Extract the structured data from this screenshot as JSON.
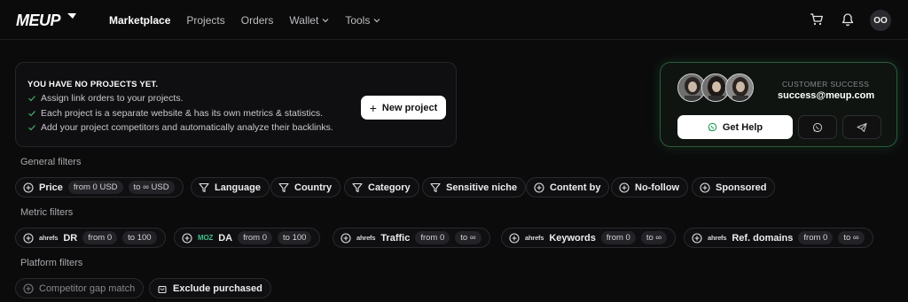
{
  "app": {
    "logo_text": "MEUP"
  },
  "nav": {
    "items": [
      {
        "label": "Marketplace",
        "active": true
      },
      {
        "label": "Projects"
      },
      {
        "label": "Orders"
      },
      {
        "label": "Wallet",
        "has_dropdown": true
      },
      {
        "label": "Tools",
        "has_dropdown": true
      }
    ]
  },
  "header_icons": {
    "cart": "cart-icon",
    "bell": "bell-icon",
    "avatar_initials": "OO"
  },
  "projects_card": {
    "title": "YOU HAVE NO PROJECTS YET.",
    "items": [
      "Assign link orders to your projects.",
      "Each project is a separate website & has its own metrics & statistics.",
      "Add your project competitors and automatically analyze their backlinks."
    ],
    "button_label": "New project"
  },
  "support_card": {
    "label": "CUSTOMER SUCCESS",
    "email": "success@meup.com",
    "get_help_label": "Get Help",
    "accent_color": "#2a5c3a"
  },
  "sections": {
    "general": "General filters",
    "metric": "Metric filters",
    "platform": "Platform filters"
  },
  "general_filters": {
    "price": {
      "label": "Price",
      "from": "from 0 USD",
      "to": "to ∞ USD"
    },
    "language": "Language",
    "country": "Country",
    "category": "Category",
    "sensitive_niche": "Sensitive niche",
    "content_by": "Content by",
    "no_follow": "No-follow",
    "sponsored": "Sponsored"
  },
  "metric_filters": {
    "dr": {
      "brand": "ahrefs",
      "label": "DR",
      "from": "from 0",
      "to": "to 100"
    },
    "da": {
      "brand": "MOZ",
      "label": "DA",
      "from": "from 0",
      "to": "to 100"
    },
    "traffic": {
      "brand": "ahrefs",
      "label": "Traffic",
      "from": "from 0",
      "to": "to ∞"
    },
    "keywords": {
      "brand": "ahrefs",
      "label": "Keywords",
      "from": "from 0",
      "to": "to ∞"
    },
    "ref_domains": {
      "brand": "ahrefs",
      "label": "Ref. domains",
      "from": "from 0",
      "to": "to ∞"
    }
  },
  "platform_filters": {
    "competitor_gap": "Competitor gap match",
    "exclude_purchased": "Exclude purchased"
  }
}
